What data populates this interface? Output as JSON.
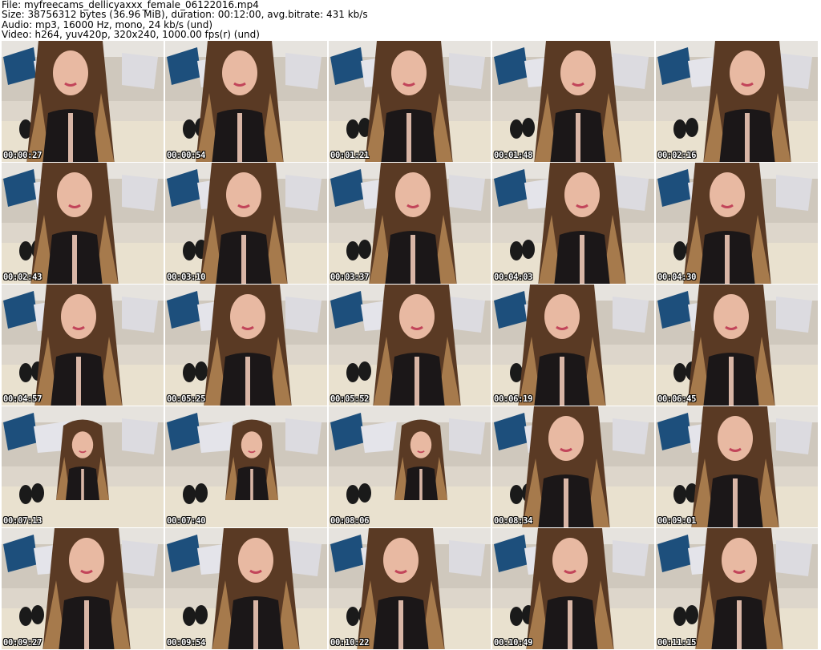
{
  "header": {
    "file": "File: myfreecams_dellicyaxxx_female_06122016.mp4",
    "size": "Size: 38756312 bytes (36.96 MiB), duration: 00:12:00, avg.bitrate: 431 kb/s",
    "audio": "Audio: mp3, 16000 Hz, mono, 24 kb/s (und)",
    "video": "Video: h264, yuv420p, 320x240, 1000.00 fps(r) (und)"
  },
  "thumbnails": [
    {
      "timestamp": "00:00:27"
    },
    {
      "timestamp": "00:00:54"
    },
    {
      "timestamp": "00:01:21"
    },
    {
      "timestamp": "00:01:48"
    },
    {
      "timestamp": "00:02:16"
    },
    {
      "timestamp": "00:02:43"
    },
    {
      "timestamp": "00:03:10"
    },
    {
      "timestamp": "00:03:37"
    },
    {
      "timestamp": "00:04:03"
    },
    {
      "timestamp": "00:04:30"
    },
    {
      "timestamp": "00:04:57"
    },
    {
      "timestamp": "00:05:25"
    },
    {
      "timestamp": "00:05:52"
    },
    {
      "timestamp": "00:06:19"
    },
    {
      "timestamp": "00:06:45"
    },
    {
      "timestamp": "00:07:13"
    },
    {
      "timestamp": "00:07:40"
    },
    {
      "timestamp": "00:08:06"
    },
    {
      "timestamp": "00:08:34"
    },
    {
      "timestamp": "00:09:01"
    },
    {
      "timestamp": "00:09:27"
    },
    {
      "timestamp": "00:09:54"
    },
    {
      "timestamp": "00:10:22"
    },
    {
      "timestamp": "00:10:49"
    },
    {
      "timestamp": "00:11:15"
    }
  ]
}
